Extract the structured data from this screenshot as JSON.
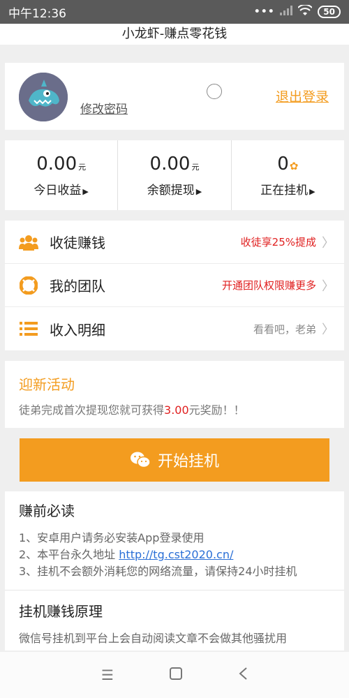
{
  "status_bar": {
    "time": "中午12:36",
    "battery": "50"
  },
  "app": {
    "title": "小龙虾-赚点零花钱"
  },
  "profile": {
    "change_password": "修改密码",
    "logout": "退出登录"
  },
  "stats": [
    {
      "value": "0.00",
      "unit": "元",
      "label": "今日收益"
    },
    {
      "value": "0.00",
      "unit": "元",
      "label": "余额提现"
    },
    {
      "value": "0",
      "unit": "",
      "label": "正在挂机"
    }
  ],
  "menu": [
    {
      "label": "收徒赚钱",
      "right": "收徒享25%提成",
      "icon": "users-icon"
    },
    {
      "label": "我的团队",
      "right": "开通团队权限赚更多",
      "icon": "lifebuoy-icon"
    },
    {
      "label": "收入明细",
      "right": "看看吧，老弟",
      "icon": "list-icon"
    }
  ],
  "promo": {
    "title": "迎新活动",
    "text_before": "徒弟完成首次提现您就可获得",
    "amount": "3.00",
    "text_after": "元奖励！！"
  },
  "start_button": {
    "label": "开始挂机"
  },
  "info": {
    "section1_title": "赚前必读",
    "line1": "1、安卓用户请务必安装App登录使用",
    "line2_prefix": "2、本平台永久地址 ",
    "line2_link": "http://tg.cst2020.cn/",
    "line3": "3、挂机不会额外消耗您的网络流量，请保持24小时挂机",
    "section2_title": "挂机赚钱原理",
    "line4": "微信号挂机到平台上会自动阅读文章不会做其他骚扰用"
  },
  "colors": {
    "accent": "#f39c1f",
    "red": "#e02020",
    "link": "#2a6fd6"
  }
}
